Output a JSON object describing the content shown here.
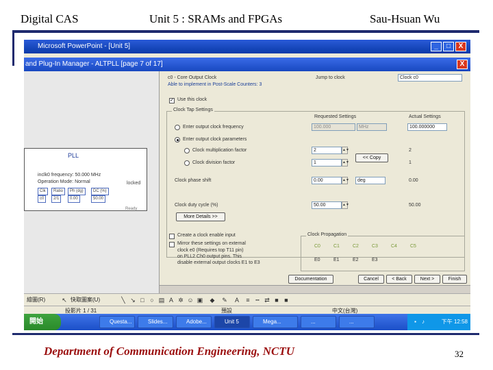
{
  "slide": {
    "header_left": "Digital CAS",
    "header_center": "Unit 5 : SRAMs and FPGAs",
    "header_right": "Sau-Hsuan Wu",
    "footer": "Department of Communication Engineering, NCTU",
    "page_number": "32"
  },
  "colors": {
    "rule": "#1e2a6e",
    "footer_text": "#9b0f0f",
    "titlebar": "#1848c0"
  },
  "powerpoint": {
    "title": "Microsoft PowerPoint - [Unit 5]",
    "buttons": {
      "minimize": "_",
      "maximize": "□",
      "close": "X"
    }
  },
  "plugin": {
    "title": "and Plug-In Manager - ALTPLL [page 7 of 17]",
    "close": "X",
    "clock_header": "c0 - Core Output Clock",
    "clock_subheader": "Able to implement in Post-Scale Counters: 3",
    "jump_label": "Jump to clock",
    "clock_select": "Clock c0",
    "use_clock": "Use this clock",
    "group_label": "Clock Tap Settings",
    "requested_label": "Requested Settings",
    "actual_label": "Actual Settings",
    "rows": {
      "enter_freq": "Enter output clock frequency",
      "enter_param": "Enter output clock parameters",
      "multiply": "Clock multiplication factor",
      "divide": "Clock division factor",
      "phase": "Clock phase shift",
      "duty": "Clock duty cycle (%)"
    },
    "values": {
      "req_freq": "100.000",
      "freq_unit": "MHz",
      "actual_freq": "100.000000",
      "multiply": "2",
      "actual_multiply": "2",
      "divide": "1",
      "actual_divide": "1",
      "phase": "0.00",
      "phase_unit": "deg",
      "actual_phase": "0.00",
      "duty": "50.00",
      "actual_duty": "50.00"
    },
    "copy_button": "<< Copy",
    "more_details": "More Details >>",
    "create_enable": "Create a clock enable input",
    "mirror_text": "Mirror these settings on external",
    "mirror_line2": "clock e0 (Requires top T11 pin)",
    "mirror_line3": "on PLL2 Ch0 output pins. This",
    "mirror_line4": "disable external output clocks E1 to E3",
    "prop_label": "Clock Propagation",
    "prop_core": [
      "C0",
      "C1",
      "C2",
      "C3",
      "C4",
      "C5"
    ],
    "prop_ext": [
      "E0",
      "E1",
      "E2",
      "E3"
    ],
    "doc_button": "Documentation",
    "cancel": "Cancel",
    "back": "< Back",
    "next": "Next >",
    "finish": "Finish"
  },
  "pll_preview": {
    "title": "PLL",
    "line1": "inclk0 frequency: 50.000 MHz",
    "line2": "Operation Mode: Normal",
    "table_headers": [
      "Clk",
      "Ratio",
      "Ph (dg)",
      "DC (%)"
    ],
    "table_values": [
      "c0",
      "2/1",
      "0.00",
      "50.00"
    ],
    "locked": "locked",
    "ready": "Ready"
  },
  "drawing_toolbar": {
    "draw": "繪圖(R)",
    "autoshapes": "快取圖案(U)"
  },
  "status_bar": {
    "slide": "投影片 1 / 31",
    "design": "預設",
    "lang": "中文(台灣)"
  },
  "taskbar": {
    "start": "開始",
    "items": [
      "Questa...",
      "Slides...",
      "Adobe...",
      "Unit 5",
      "Mega...",
      "...",
      "..."
    ],
    "clock": "下午 12:58"
  }
}
